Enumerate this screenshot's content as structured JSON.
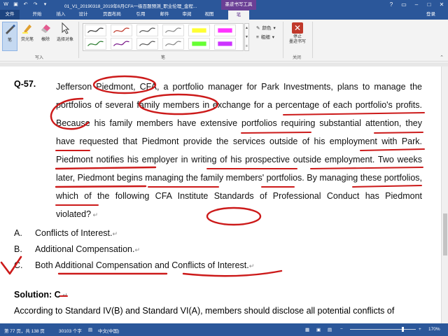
{
  "titlebar": {
    "title": "01_V1_20190318_2019年6月CFA一级百题预测_职业伦理_金程...",
    "context_tab": "墨迹书写工具",
    "icons": [
      "save-icon",
      "undo-icon",
      "redo-icon",
      "customize-icon"
    ]
  },
  "tabs": [
    {
      "label": "文件"
    },
    {
      "label": "开始"
    },
    {
      "label": "插入"
    },
    {
      "label": "设计"
    },
    {
      "label": "页面布局"
    },
    {
      "label": "引用"
    },
    {
      "label": "邮件"
    },
    {
      "label": "审阅"
    },
    {
      "label": "视图"
    },
    {
      "label": "笔"
    }
  ],
  "signin": "登录",
  "ribbon": {
    "write_group": {
      "label": "写入",
      "buttons": [
        {
          "label": "笔"
        },
        {
          "label": "荧光笔"
        },
        {
          "label": "橡除"
        },
        {
          "label": "选择对象"
        }
      ]
    },
    "pens_group": {
      "label": "笔"
    },
    "color_label": "颜色",
    "thickness_label": "粗细",
    "close_group": {
      "label": "关闭",
      "stop_label_line1": "停止",
      "stop_label_line2": "墨迹书写"
    },
    "pen_colors": [
      "#3a3a3a",
      "#c0392b",
      "#555555",
      "#8a8a8a",
      "#ffff33",
      "#ff33ff",
      "#2e7d32",
      "#7a1a8a",
      "#5a5a5a",
      "#888888",
      "#66ff33",
      "#cc33ff"
    ]
  },
  "document": {
    "question_number": "Q-57.",
    "question_text": "Jefferson Piedmont, CFA, a portfolio manager for Park Investments, plans to manage the portfolios of several family members in exchange for a percentage of each portfolio's profits. Because his family members have extensive portfolios requiring substantial attention, they have requested that Piedmont provide the services outside of his employment with Park. Piedmont notifies his employer in writing of his prospective outside employment. Two weeks later, Piedmont begins managing the family members' portfolios. By managing these portfolios, which of the following CFA Institute Standards of Professional Conduct has Piedmont violated?",
    "options": [
      {
        "label": "A.",
        "text": "Conflicts of Interest."
      },
      {
        "label": "B.",
        "text": "Additional Compensation."
      },
      {
        "label": "C.",
        "text": "Both Additional Compensation and Conflicts of Interest."
      }
    ],
    "solution_heading": "Solution: C",
    "solution_text": "According to Standard IV(B) and Standard VI(A), members should disclose all potential conflicts of",
    "ink_color": "#cc1a1a"
  },
  "status": {
    "page": "第 77 页，共 138 页",
    "words": "30103 个字",
    "language": "中文(中国)",
    "zoom": "170%"
  }
}
